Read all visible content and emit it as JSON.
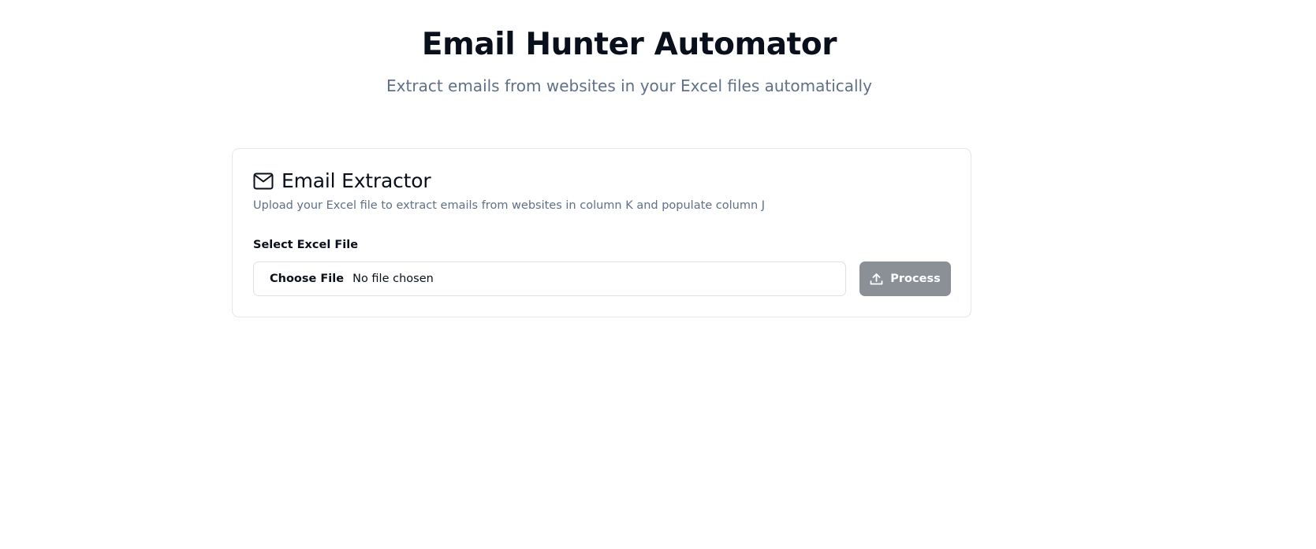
{
  "header": {
    "title": "Email Hunter Automator",
    "subtitle": "Extract emails from websites in your Excel files automatically"
  },
  "card": {
    "icon": "mail-icon",
    "title": "Email Extractor",
    "description": "Upload your Excel file to extract emails from websites in column K and populate column J",
    "field_label": "Select Excel File",
    "file_input": {
      "button_label": "Choose File",
      "status": "No file chosen"
    },
    "process_button": {
      "icon": "upload-icon",
      "label": "Process",
      "color": "#8b8f96"
    }
  },
  "colors": {
    "title_text": "#0a0f1c",
    "muted_text": "#5f7088",
    "border": "#e3e6ea"
  }
}
